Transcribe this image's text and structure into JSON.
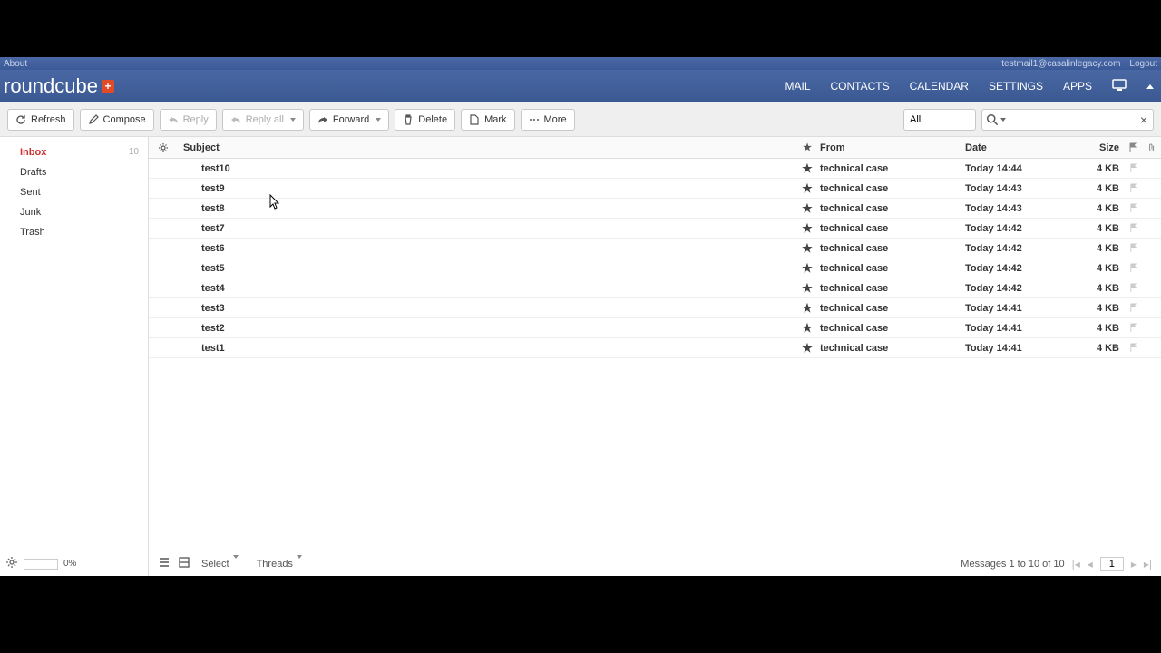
{
  "topbar": {
    "about": "About",
    "user": "testmail1@casalinlegacy.com",
    "logout": "Logout"
  },
  "logo": {
    "text": "roundcube"
  },
  "nav": {
    "mail": "MAIL",
    "contacts": "CONTACTS",
    "calendar": "CALENDAR",
    "settings": "SETTINGS",
    "apps": "APPS"
  },
  "toolbar": {
    "refresh": "Refresh",
    "compose": "Compose",
    "reply": "Reply",
    "replyall": "Reply all",
    "forward": "Forward",
    "delete": "Delete",
    "mark": "Mark",
    "more": "More",
    "filter": "All"
  },
  "sidebar": {
    "folders": [
      {
        "name": "Inbox",
        "count": "10",
        "active": true
      },
      {
        "name": "Drafts",
        "count": "",
        "active": false
      },
      {
        "name": "Sent",
        "count": "",
        "active": false
      },
      {
        "name": "Junk",
        "count": "",
        "active": false
      },
      {
        "name": "Trash",
        "count": "",
        "active": false
      }
    ],
    "quota": "0%"
  },
  "columns": {
    "subject": "Subject",
    "from": "From",
    "date": "Date",
    "size": "Size"
  },
  "messages": [
    {
      "subject": "test10",
      "from": "technical case",
      "date": "Today 14:44",
      "size": "4 KB"
    },
    {
      "subject": "test9",
      "from": "technical case",
      "date": "Today 14:43",
      "size": "4 KB"
    },
    {
      "subject": "test8",
      "from": "technical case",
      "date": "Today 14:43",
      "size": "4 KB"
    },
    {
      "subject": "test7",
      "from": "technical case",
      "date": "Today 14:42",
      "size": "4 KB"
    },
    {
      "subject": "test6",
      "from": "technical case",
      "date": "Today 14:42",
      "size": "4 KB"
    },
    {
      "subject": "test5",
      "from": "technical case",
      "date": "Today 14:42",
      "size": "4 KB"
    },
    {
      "subject": "test4",
      "from": "technical case",
      "date": "Today 14:42",
      "size": "4 KB"
    },
    {
      "subject": "test3",
      "from": "technical case",
      "date": "Today 14:41",
      "size": "4 KB"
    },
    {
      "subject": "test2",
      "from": "technical case",
      "date": "Today 14:41",
      "size": "4 KB"
    },
    {
      "subject": "test1",
      "from": "technical case",
      "date": "Today 14:41",
      "size": "4 KB"
    }
  ],
  "footer": {
    "select": "Select",
    "threads": "Threads",
    "status": "Messages 1 to 10 of 10",
    "page": "1"
  }
}
